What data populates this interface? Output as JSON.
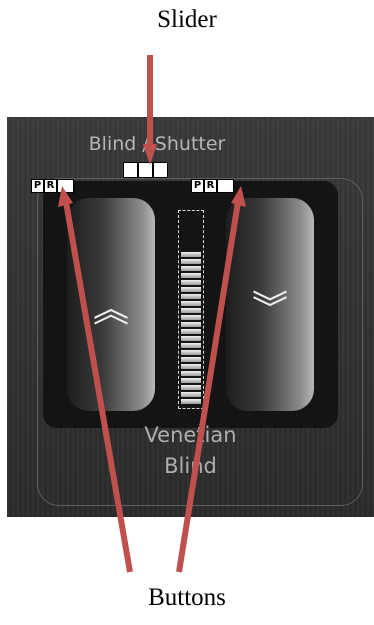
{
  "annotations": {
    "slider_label": "Slider",
    "buttons_label": "Buttons",
    "arrow_color": "#c0504d"
  },
  "widget": {
    "title": "Blind / Shutter",
    "name_line1": "Venetian",
    "name_line2": "Blind",
    "up_button": {
      "icon": "double-chevron-up-icon",
      "glyph": "︽"
    },
    "down_button": {
      "icon": "double-chevron-down-icon",
      "glyph": "︾"
    },
    "left_pr": {
      "p": "P",
      "r": "R"
    },
    "right_pr": {
      "p": "P",
      "r": "R"
    },
    "slider_level": 0.77
  }
}
